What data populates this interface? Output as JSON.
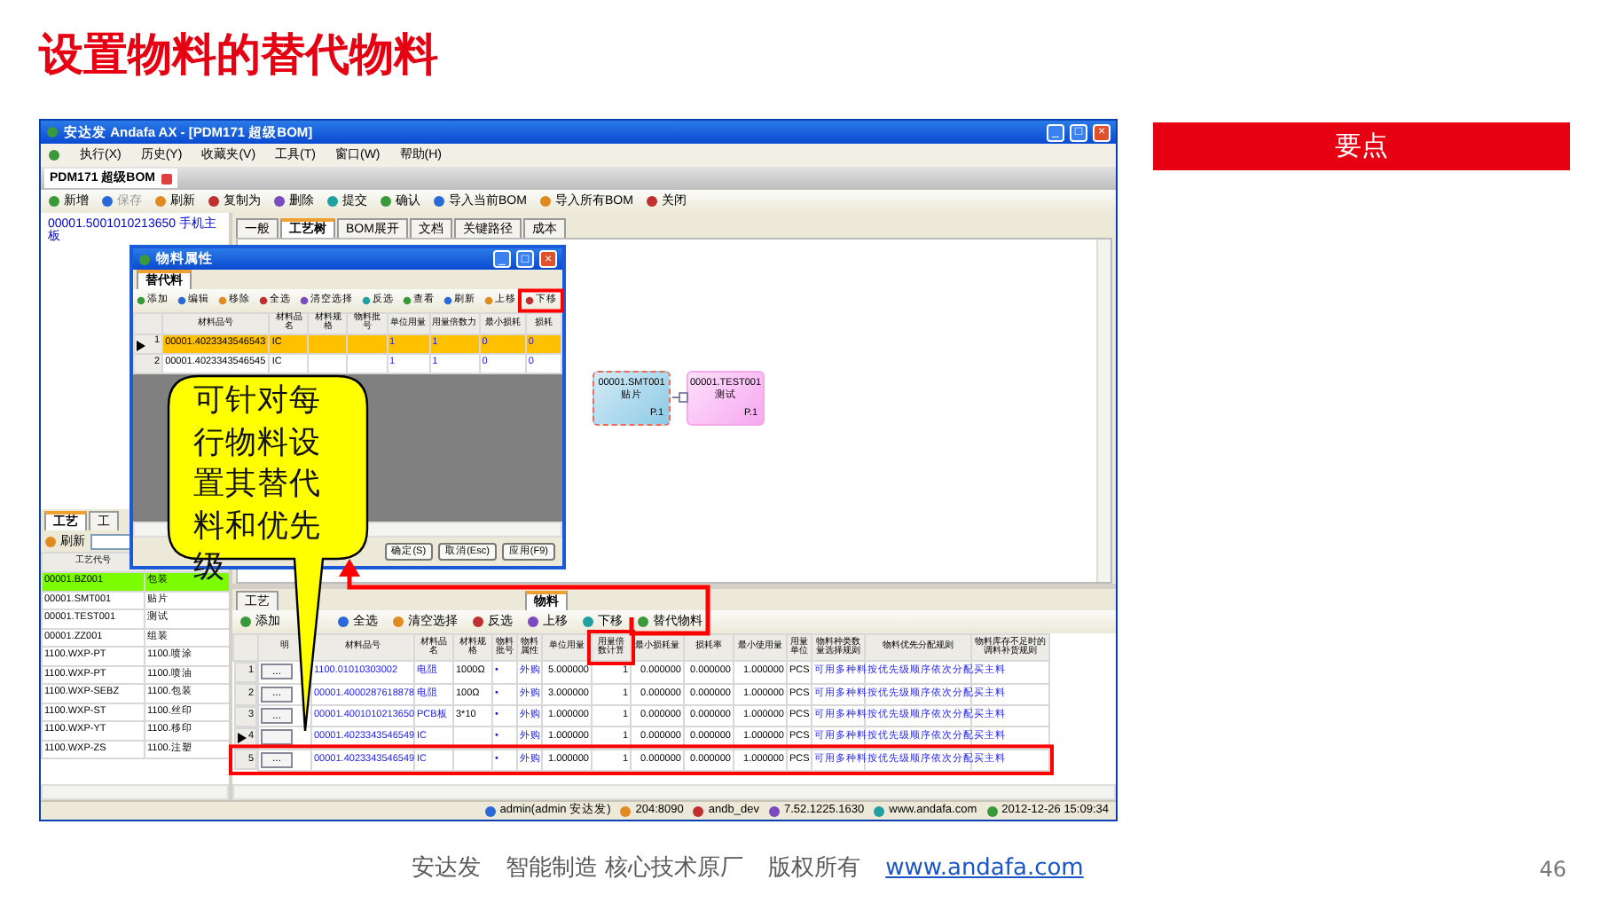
{
  "slide_title": "设置物料的替代物料",
  "app": {
    "title": "安达发 Andafa AX - [PDM171 超级BOM]",
    "window_buttons": [
      "_",
      "□",
      "×"
    ],
    "menu": [
      "执行(X)",
      "历史(Y)",
      "收藏夹(V)",
      "工具(T)",
      "窗口(W)",
      "帮助(H)"
    ],
    "doc_tab": "PDM171 超级BOM",
    "toolbar": [
      {
        "label": "新增",
        "disabled": false
      },
      {
        "label": "保存",
        "disabled": true
      },
      {
        "label": "刷新",
        "disabled": false
      },
      {
        "label": "复制为",
        "disabled": false
      },
      {
        "label": "删除",
        "disabled": false
      },
      {
        "label": "提交",
        "disabled": false
      },
      {
        "label": "确认",
        "disabled": false
      },
      {
        "label": "导入当前BOM",
        "disabled": false
      },
      {
        "label": "导入所有BOM",
        "disabled": false
      },
      {
        "label": "关闭",
        "disabled": false
      }
    ],
    "tree": [
      {
        "label": "00001.5001010213650 手机主板"
      }
    ],
    "view_tabs": [
      {
        "label": "一般",
        "selected": false
      },
      {
        "label": "工艺树",
        "selected": true
      },
      {
        "label": "BOM展开",
        "selected": false
      },
      {
        "label": "文档",
        "selected": false
      },
      {
        "label": "关键路径",
        "selected": false
      },
      {
        "label": "成本",
        "selected": false
      }
    ],
    "diagram": {
      "nodes": [
        {
          "code": "00001.SMT001",
          "name": "贴片",
          "tag": "P.1",
          "kind": "current"
        },
        {
          "code": "00001.TEST001",
          "name": "测试",
          "tag": "P.1",
          "kind": "normal"
        }
      ]
    },
    "routing_panel": {
      "tabs": [
        {
          "label": "工艺",
          "selected": true
        },
        {
          "label": "工",
          "selected": false
        }
      ],
      "refresh": "刷新",
      "columns": [
        "工艺代号"
      ],
      "rows": [
        {
          "code": "00001.BZ001",
          "name": "包装",
          "selected": true
        },
        {
          "code": "00001.SMT001",
          "name": "贴片",
          "selected": false
        },
        {
          "code": "00001.TEST001",
          "name": "测试",
          "selected": false
        },
        {
          "code": "00001.ZZ001",
          "name": "组装",
          "selected": false
        },
        {
          "code": "1100.WXP-PT",
          "name": "1100.喷涂",
          "selected": false
        },
        {
          "code": "1100.WXP-PT",
          "name": "1100.喷油",
          "selected": false
        },
        {
          "code": "1100.WXP-SEBZ",
          "name": "1100.包装",
          "selected": false
        },
        {
          "code": "1100.WXP-ST",
          "name": "1100.丝印",
          "selected": false
        },
        {
          "code": "1100.WXP-YT",
          "name": "1100.移印",
          "selected": false
        },
        {
          "code": "1100.WXP-ZS",
          "name": "1100.注塑",
          "selected": false
        }
      ]
    },
    "detail_panel": {
      "tabs": [
        {
          "label": "工艺",
          "selected": false
        },
        {
          "label": "物料",
          "selected": true
        }
      ],
      "toolbar": [
        "添加",
        "全选",
        "清空选择",
        "反选",
        "上移",
        "下移",
        "替代物料"
      ],
      "columns": [
        "明",
        "材料品号",
        "材料品名",
        "材料规格",
        "物料批号",
        "物料属性",
        "单位用量",
        "用量倍数计算",
        "最小损耗量",
        "损耗率",
        "最小使用量",
        "用量单位",
        "物料种类数量选择规则",
        "物料优先分配规则",
        "物料库存不足时的调料补货规则"
      ],
      "rows": [
        {
          "number": "1",
          "current": false,
          "cells": [
            "...",
            "1100.01010303002",
            "电阻",
            "1000Ω",
            "•",
            "外购",
            "5.000000",
            "1",
            "0.000000",
            "0.000000",
            "1.000000",
            "PCS",
            "可用多种料",
            "按优先级顺序依次分配",
            "买主料"
          ]
        },
        {
          "number": "2",
          "current": false,
          "cells": [
            "...",
            "00001.4000287618878",
            "电阻",
            "100Ω",
            "•",
            "外购",
            "3.000000",
            "1",
            "0.000000",
            "0.000000",
            "1.000000",
            "PCS",
            "可用多种料",
            "按优先级顺序依次分配",
            "买主料"
          ]
        },
        {
          "number": "3",
          "current": false,
          "cells": [
            "...",
            "00001.4001010213650",
            "PCB板",
            "3*10",
            "•",
            "外购",
            "1.000000",
            "1",
            "0.000000",
            "0.000000",
            "1.000000",
            "PCS",
            "可用多种料",
            "按优先级顺序依次分配",
            "买主料"
          ]
        },
        {
          "number": "4",
          "current": true,
          "cells": [
            null,
            "00001.4023343546549",
            "IC",
            null,
            "•",
            "外购",
            "1.000000",
            "1",
            "0.000000",
            "0.000000",
            "1.000000",
            "PCS",
            "可用多种料",
            "按优先级顺序依次分配",
            "买主料"
          ]
        },
        {
          "number": "5",
          "current": false,
          "cells": [
            "...",
            "00001.4023343546549",
            "IC",
            null,
            "•",
            "外购",
            "1.000000",
            "1",
            "0.000000",
            "0.000000",
            "1.000000",
            "PCS",
            "可用多种料",
            "按优先级顺序依次分配",
            "买主料"
          ]
        }
      ]
    },
    "status_bar": [
      "admin(admin 安达发)",
      "204:8090",
      "andb_dev",
      "7.52.1225.1630",
      "www.andafa.com",
      "2012-12-26 15:09:34"
    ],
    "dialog": {
      "title": "物料属性",
      "tab": "替代料",
      "toolbar": [
        "添加",
        "编辑",
        "移除",
        "全选",
        "清空选择",
        "反选",
        "查看",
        "刷新",
        "上移",
        "下移"
      ],
      "columns": [
        "材料品号",
        "材料品名",
        "材料规格",
        "物料批号",
        "单位用量",
        "用量倍数力",
        "最小损耗",
        "损耗"
      ],
      "rows": [
        {
          "number": "1",
          "selected": true,
          "cells": [
            "00001.4023343546543",
            "IC",
            null,
            null,
            "1",
            "1",
            "0",
            "0"
          ]
        },
        {
          "number": "2",
          "selected": false,
          "cells": [
            "00001.4023343546545",
            "IC",
            null,
            null,
            "1",
            "1",
            "0",
            "0"
          ]
        }
      ],
      "buttons": [
        "确定(S)",
        "取消(Esc)",
        "应用(F9)"
      ]
    }
  },
  "callout": "可针对每行物料设置其替代料和优先级",
  "aside": {
    "heading": "要点"
  },
  "footer": {
    "parts": [
      "安达发",
      "智能制造 核心技术原厂",
      "版权所有"
    ],
    "link": "www.andafa.com",
    "page": "46"
  }
}
